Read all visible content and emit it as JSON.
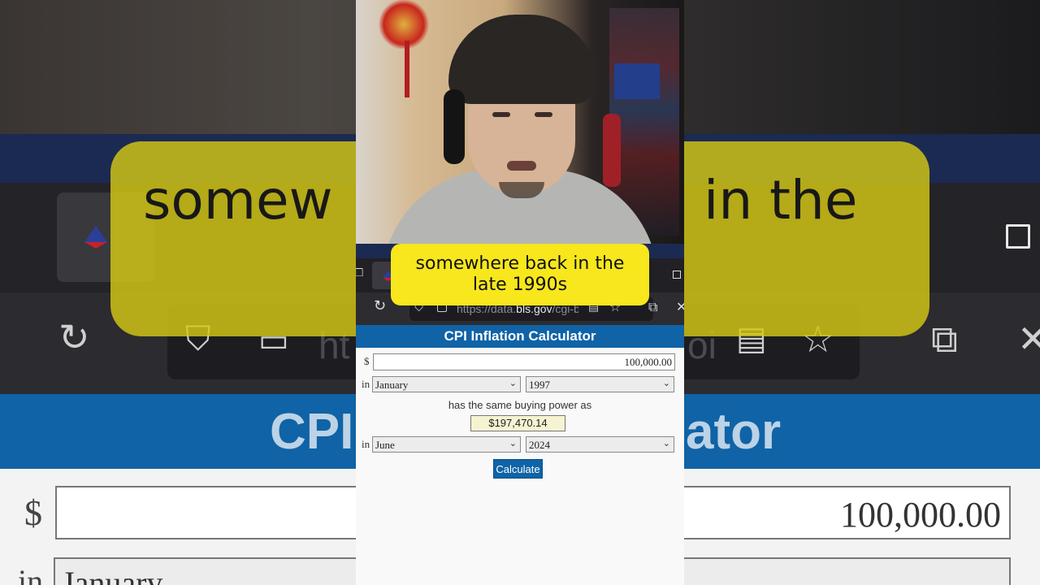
{
  "background_zoom": {
    "caption_word_left": "somew",
    "caption_word_right": "in the",
    "url_fragment_left": "ht",
    "url_fragment_right": "oi",
    "header_left": "CPI",
    "header_right": "ator",
    "amount": "100,000.00",
    "currency": "$",
    "in_label": "in",
    "month": "January"
  },
  "caption": {
    "line1": "somewhere back in the",
    "line2": "late 1990s"
  },
  "browser": {
    "url_prefix": "https://data.",
    "url_domain": "bls.gov",
    "url_suffix": "/cgi-b"
  },
  "calculator": {
    "title": "CPI Inflation Calculator",
    "currency_symbol": "$",
    "amount_value": "100,000.00",
    "in_label": "in",
    "from_month": "January",
    "from_year": "1997",
    "same_power_text": "has the same buying power as",
    "result_value": "$197,470.14",
    "to_month": "June",
    "to_year": "2024",
    "calculate_label": "Calculate"
  },
  "colors": {
    "header_blue": "#0f63a6",
    "caption_yellow": "#f7e71c",
    "result_bg": "#f6f3d2"
  }
}
